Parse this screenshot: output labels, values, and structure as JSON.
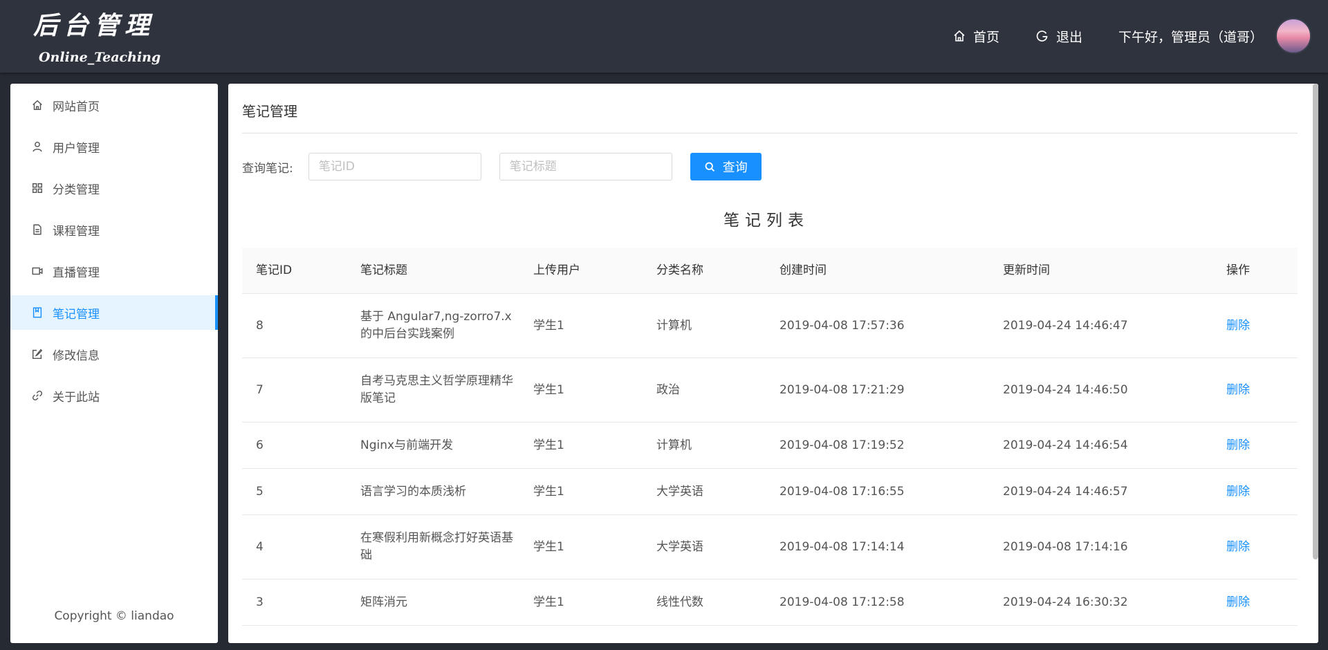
{
  "header": {
    "logo_title": "后台管理",
    "logo_subtitle": "Online_Teaching",
    "nav_home": "首页",
    "nav_logout": "退出",
    "greeting": "下午好，管理员（道哥）"
  },
  "sidebar": {
    "items": [
      {
        "label": "网站首页",
        "icon": "home-icon"
      },
      {
        "label": "用户管理",
        "icon": "user-icon"
      },
      {
        "label": "分类管理",
        "icon": "grid-icon"
      },
      {
        "label": "课程管理",
        "icon": "document-icon"
      },
      {
        "label": "直播管理",
        "icon": "video-icon"
      },
      {
        "label": "笔记管理",
        "icon": "book-icon",
        "active": true
      },
      {
        "label": "修改信息",
        "icon": "edit-icon"
      },
      {
        "label": "关于此站",
        "icon": "link-icon"
      }
    ],
    "copyright": "Copyright © liandao"
  },
  "main": {
    "title": "笔记管理",
    "search": {
      "label": "查询笔记:",
      "id_placeholder": "笔记ID",
      "title_placeholder": "笔记标题",
      "button": "查询"
    },
    "list_title": "笔记列表",
    "columns": [
      "笔记ID",
      "笔记标题",
      "上传用户",
      "分类名称",
      "创建时间",
      "更新时间",
      "操作"
    ],
    "rows": [
      {
        "id": "8",
        "title": "基于 Angular7,ng-zorro7.x的中后台实践案例",
        "user": "学生1",
        "category": "计算机",
        "created": "2019-04-08 17:57:36",
        "updated": "2019-04-24 14:46:47",
        "action": "删除"
      },
      {
        "id": "7",
        "title": "自考马克思主义哲学原理精华版笔记",
        "user": "学生1",
        "category": "政治",
        "created": "2019-04-08 17:21:29",
        "updated": "2019-04-24 14:46:50",
        "action": "删除"
      },
      {
        "id": "6",
        "title": "Nginx与前端开发",
        "user": "学生1",
        "category": "计算机",
        "created": "2019-04-08 17:19:52",
        "updated": "2019-04-24 14:46:54",
        "action": "删除"
      },
      {
        "id": "5",
        "title": "语言学习的本质浅析",
        "user": "学生1",
        "category": "大学英语",
        "created": "2019-04-08 17:16:55",
        "updated": "2019-04-24 14:46:57",
        "action": "删除"
      },
      {
        "id": "4",
        "title": "在寒假利用新概念打好英语基础",
        "user": "学生1",
        "category": "大学英语",
        "created": "2019-04-08 17:14:14",
        "updated": "2019-04-08 17:14:16",
        "action": "删除"
      },
      {
        "id": "3",
        "title": "矩阵消元",
        "user": "学生1",
        "category": "线性代数",
        "created": "2019-04-08 17:12:58",
        "updated": "2019-04-24 16:30:32",
        "action": "删除"
      }
    ]
  },
  "colors": {
    "header_bg": "#2f333e",
    "page_bg": "#262a33",
    "accent": "#1890ff",
    "active_menu_bg": "#e6f4ff"
  }
}
